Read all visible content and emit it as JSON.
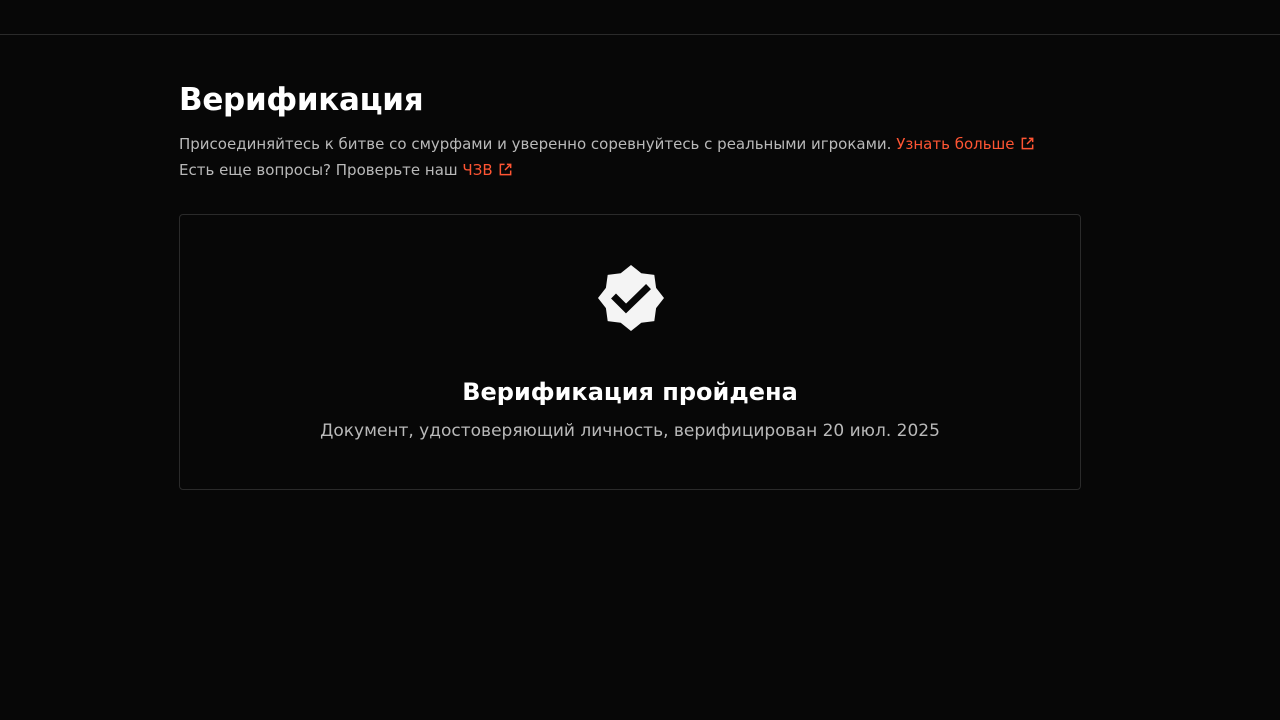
{
  "header": {
    "title": "Верификация",
    "description_text": "Присоединяйтесь к битве со смурфами и уверенно соревнуйтесь с реальными игроками.",
    "learn_more_label": "Узнать больше",
    "faq_prompt": "Есть еще вопросы? Проверьте наш",
    "faq_label": "ЧЗВ"
  },
  "status_card": {
    "icon": "verified-badge-icon",
    "title": "Верификация пройдена",
    "subtitle": "Документ, удостоверяющий личность, верифицирован 20 июл. 2025"
  },
  "colors": {
    "background": "#070707",
    "accent": "#ff5533",
    "text_primary": "#ffffff",
    "text_secondary": "#b9b9b9",
    "border": "#2a2a2a"
  }
}
